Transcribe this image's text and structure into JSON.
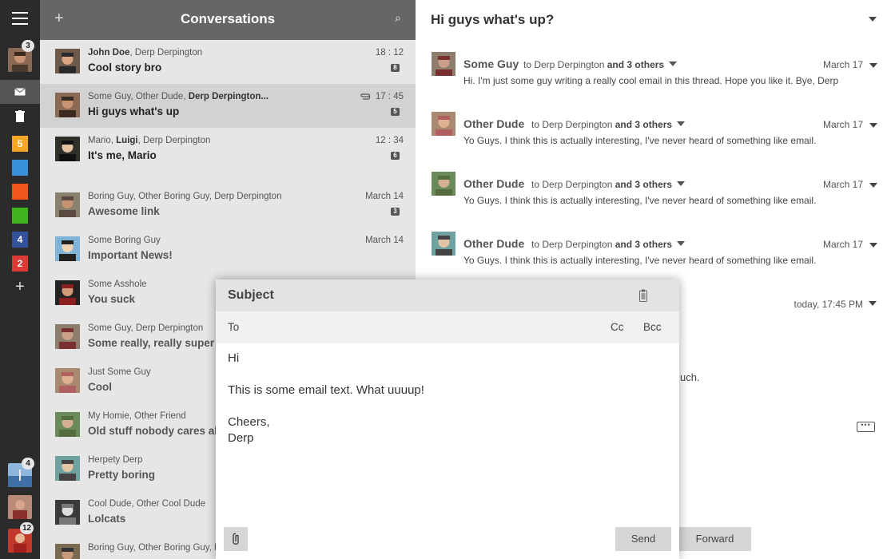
{
  "rail": {
    "account_badge": "3",
    "folders": [
      {
        "name": "orange",
        "count": "5",
        "color": "#f5a623"
      },
      {
        "name": "blue",
        "count": "",
        "color": "#3a8fd9"
      },
      {
        "name": "red-orange",
        "count": "",
        "color": "#f0561b"
      },
      {
        "name": "green",
        "count": "",
        "color": "#3fb41f"
      },
      {
        "name": "dark-blue",
        "count": "4",
        "color": "#34519b"
      },
      {
        "name": "red",
        "count": "2",
        "color": "#dd3a35"
      }
    ],
    "add_symbol": "+",
    "bottom_badges": [
      "4",
      "",
      "12"
    ]
  },
  "list": {
    "header_title": "Conversations",
    "add_symbol": "+",
    "search_symbol": "⌕",
    "items": [
      {
        "from_plain": "",
        "from_bold": "John Doe",
        "from_rest": ", Derp Derpington",
        "subject": "Cool story bro",
        "time": "18 : 12",
        "count": "8",
        "attachment": false
      },
      {
        "from_plain": "Some Guy, Other Dude, ",
        "from_bold": "Derp Derpington...",
        "from_rest": "",
        "subject": "Hi guys what's up",
        "time": "17 : 45",
        "count": "5",
        "attachment": true
      },
      {
        "from_plain": "Mario, ",
        "from_bold": "Luigi",
        "from_rest": ", Derp Derpington",
        "subject": "It's me, Mario",
        "time": "12 : 34",
        "count": "6",
        "attachment": false
      },
      {
        "from_plain": "Boring Guy, Other Boring Guy, Derp Derpington",
        "from_bold": "",
        "from_rest": "",
        "subject": "Awesome link",
        "time": "March 14",
        "count": "3",
        "attachment": false
      },
      {
        "from_plain": "Some Boring Guy",
        "from_bold": "",
        "from_rest": "",
        "subject": "Important News!",
        "time": "March 14",
        "count": "",
        "attachment": false
      },
      {
        "from_plain": "Some Asshole",
        "from_bold": "",
        "from_rest": "",
        "subject": "You suck",
        "time": "",
        "count": "",
        "attachment": false
      },
      {
        "from_plain": "Some Guy, Derp Derpington",
        "from_bold": "",
        "from_rest": "",
        "subject": "Some really, really super",
        "time": "",
        "count": "",
        "attachment": false
      },
      {
        "from_plain": "Just Some Guy",
        "from_bold": "",
        "from_rest": "",
        "subject": "Cool",
        "time": "",
        "count": "",
        "attachment": false
      },
      {
        "from_plain": "My Homie, Other Friend",
        "from_bold": "",
        "from_rest": "",
        "subject": "Old stuff nobody cares al",
        "time": "",
        "count": "",
        "attachment": false
      },
      {
        "from_plain": "Herpety Derp",
        "from_bold": "",
        "from_rest": "",
        "subject": "Pretty boring",
        "time": "",
        "count": "",
        "attachment": false
      },
      {
        "from_plain": "Cool Dude, Other Cool Dude",
        "from_bold": "",
        "from_rest": "",
        "subject": "Lolcats",
        "time": "",
        "count": "",
        "attachment": false
      },
      {
        "from_plain": "Boring Guy, Other Boring Guy, D",
        "from_bold": "",
        "from_rest": "",
        "subject": "",
        "time": "",
        "count": "",
        "attachment": false
      }
    ]
  },
  "thread": {
    "title": "Hi guys what's up?",
    "messages": [
      {
        "sender": "Some Guy",
        "to_plain": "to Derp Derpington ",
        "to_bold": "and 3 others",
        "date": "March 17",
        "body": "Hi. I'm just some guy writing a really cool email in this thread. Hope you like it. Bye, Derp"
      },
      {
        "sender": "Other Dude",
        "to_plain": "to Derp Derpington ",
        "to_bold": "and 3 others",
        "date": "March 17",
        "body": "Yo Guys. I think this is actually interesting, I've never heard of something like email."
      },
      {
        "sender": "Other Dude",
        "to_plain": "to Derp Derpington ",
        "to_bold": "and 3 others",
        "date": "March 17",
        "body": "Yo Guys. I think this is actually interesting, I've never heard of something like email."
      },
      {
        "sender": "Other Dude",
        "to_plain": "to Derp Derpington ",
        "to_bold": "and 3 others",
        "date": "March 17",
        "body": "Yo Guys. I think this is actually interesting, I've never heard of something like email."
      }
    ],
    "today_time": "today, 17:45 PM",
    "partial_body": "uch.",
    "more_label": "•••",
    "forward_label": "Forward"
  },
  "compose": {
    "subject_label": "Subject",
    "to_label": "To",
    "cc_label": "Cc",
    "bcc_label": "Bcc",
    "body_lines": [
      "Hi",
      "This is some email text. What uuuup!",
      "Cheers,",
      "Derp"
    ],
    "send_label": "Send"
  }
}
